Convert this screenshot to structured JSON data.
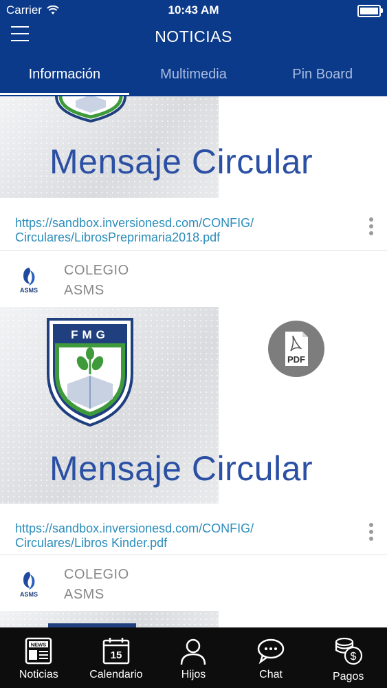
{
  "status_bar": {
    "carrier": "Carrier",
    "time": "10:43 AM"
  },
  "header": {
    "title": "NOTICIAS"
  },
  "tabs": [
    {
      "label": "Información",
      "active": true
    },
    {
      "label": "Multimedia",
      "active": false
    },
    {
      "label": "Pin Board",
      "active": false
    }
  ],
  "posts": [
    {
      "headline": "Mensaje Circular",
      "link_line1": "https://sandbox.inversionesd.com/CONFIG/",
      "link_line2": "Circulares/LibrosPreprimaria2018.pdf",
      "author_line1": "COLEGIO",
      "author_line2": "ASMS",
      "logo_text": "ASMS"
    },
    {
      "crest_text": "FMG",
      "pdf_label": "PDF",
      "headline": "Mensaje Circular",
      "link_line1": "https://sandbox.inversionesd.com/CONFIG/",
      "link_line2": "Circulares/Libros Kinder.pdf",
      "author_line1": "COLEGIO",
      "author_line2": "ASMS",
      "logo_text": "ASMS"
    }
  ],
  "tabbar": [
    {
      "label": "Noticias",
      "icon": "newspaper-icon",
      "badge": "NEWS"
    },
    {
      "label": "Calendario",
      "icon": "calendar-icon",
      "day": "15"
    },
    {
      "label": "Hijos",
      "icon": "person-icon"
    },
    {
      "label": "Chat",
      "icon": "chat-bubble-icon"
    },
    {
      "label": "Pagos",
      "icon": "coins-dollar-icon",
      "symbol": "$"
    }
  ],
  "colors": {
    "header": "#0c3a8a",
    "link": "#2b8dbb",
    "headline": "#2a4fa3",
    "tabbar": "#0d0d0d"
  }
}
